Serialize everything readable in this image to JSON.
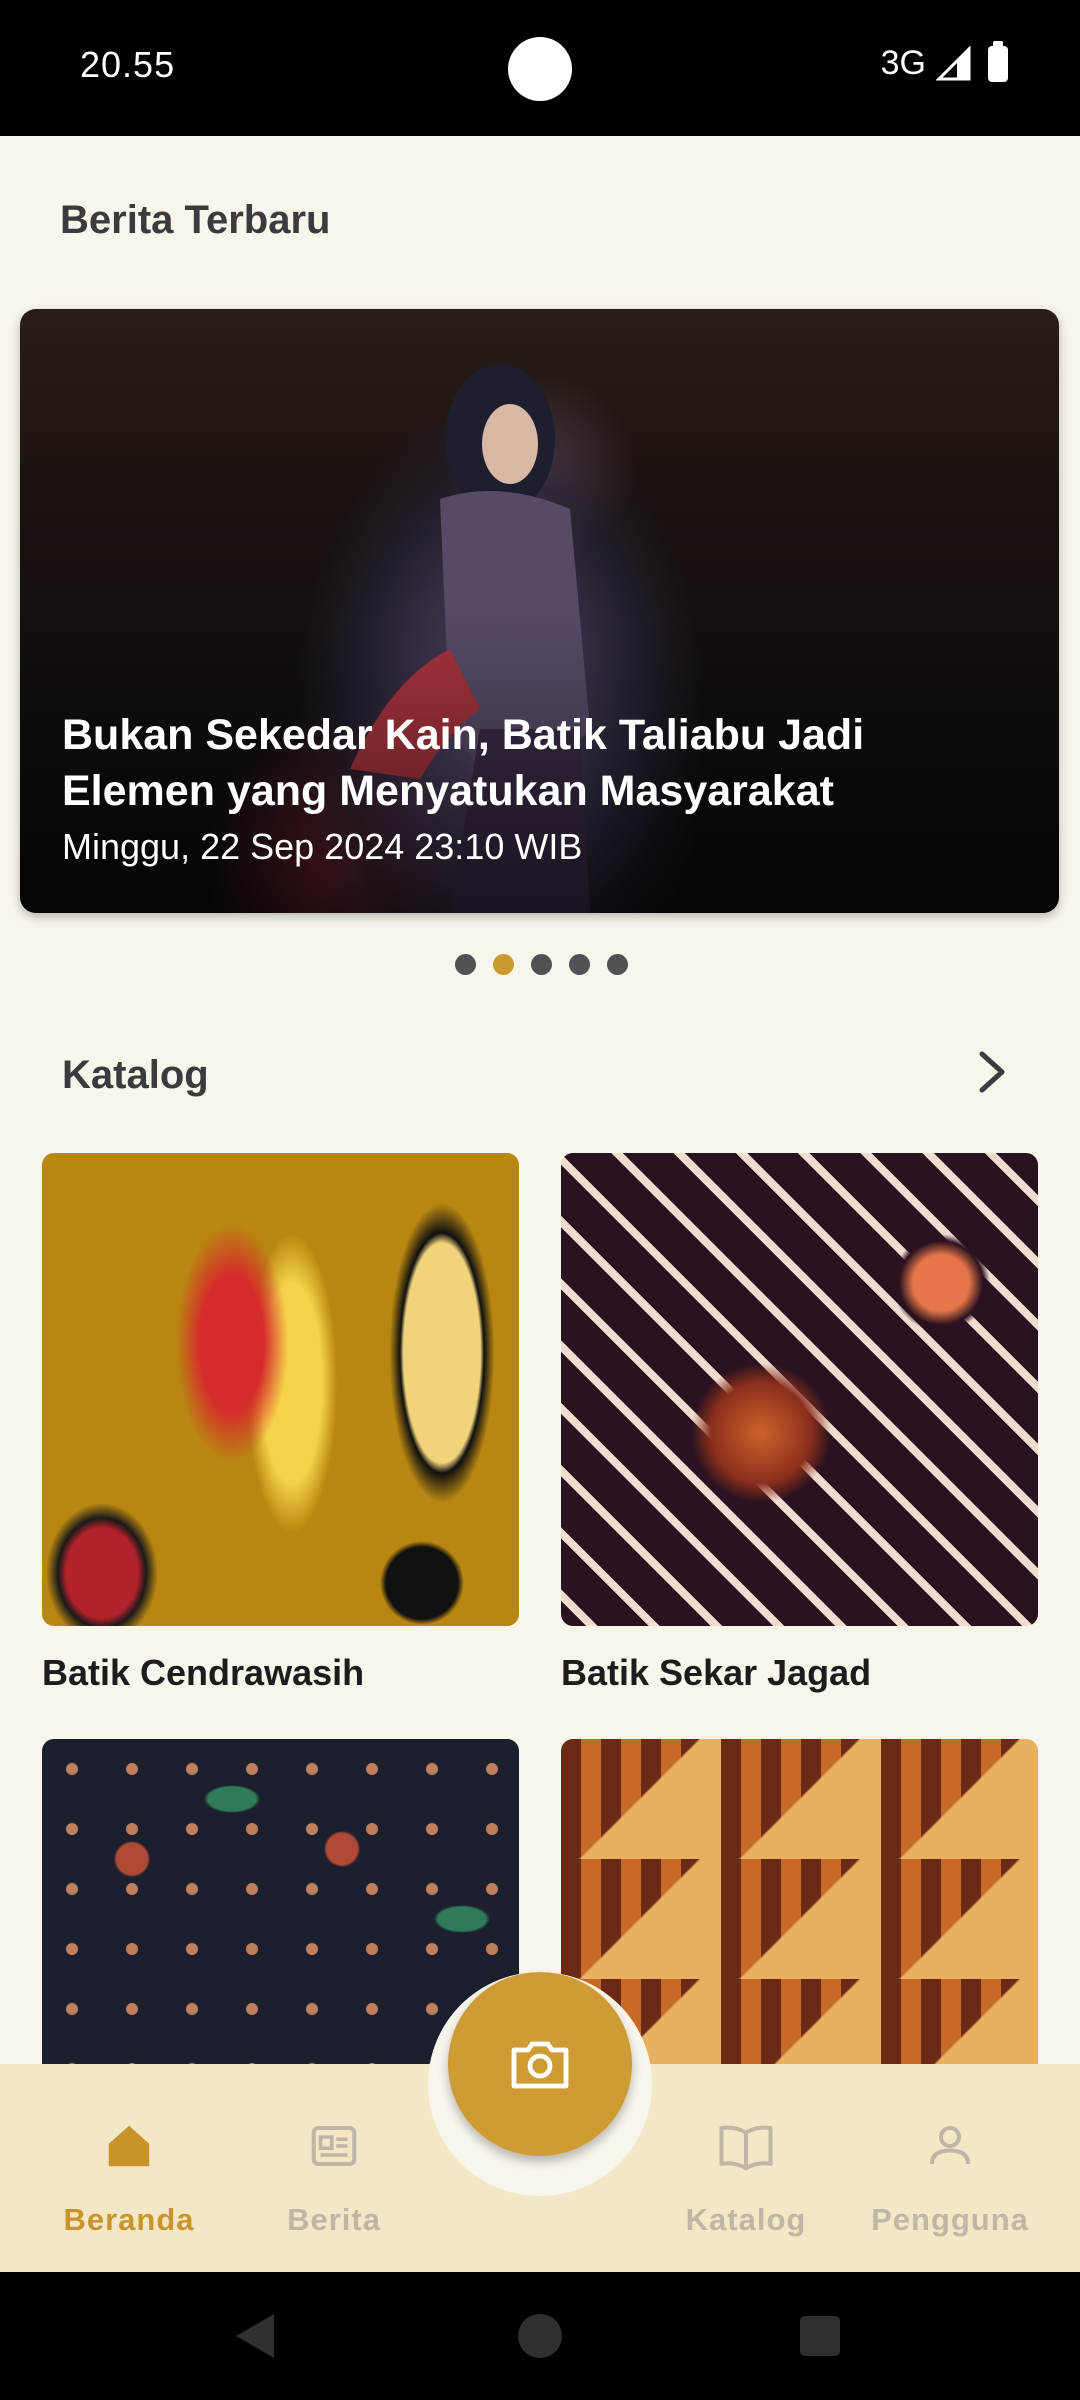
{
  "status_bar": {
    "time": "20.55",
    "network": "3G"
  },
  "news": {
    "section_title": "Berita Terbaru",
    "headline": "Bukan Sekedar Kain, Batik Taliabu Jadi Elemen yang Menyatukan Masyarakat",
    "date": "Minggu, 22 Sep 2024 23:10 WIB",
    "slide_count": 5,
    "active_slide": 2
  },
  "catalog": {
    "section_title": "Katalog",
    "items": [
      {
        "label": "Batik Cendrawasih"
      },
      {
        "label": "Batik Sekar Jagad"
      },
      {
        "label": ""
      },
      {
        "label": ""
      }
    ]
  },
  "bottom_nav": {
    "items": [
      {
        "label": "Beranda",
        "icon": "home-icon",
        "active": true
      },
      {
        "label": "Berita",
        "icon": "newspaper-icon",
        "active": false
      },
      {
        "label": "Katalog",
        "icon": "book-icon",
        "active": false
      },
      {
        "label": "Pengguna",
        "icon": "user-icon",
        "active": false
      }
    ],
    "fab_icon": "camera-icon"
  },
  "colors": {
    "accent": "#cf9c34",
    "background": "#f8f5ea",
    "nav_background": "#f4e7c6",
    "inactive": "#bfb6a6"
  }
}
